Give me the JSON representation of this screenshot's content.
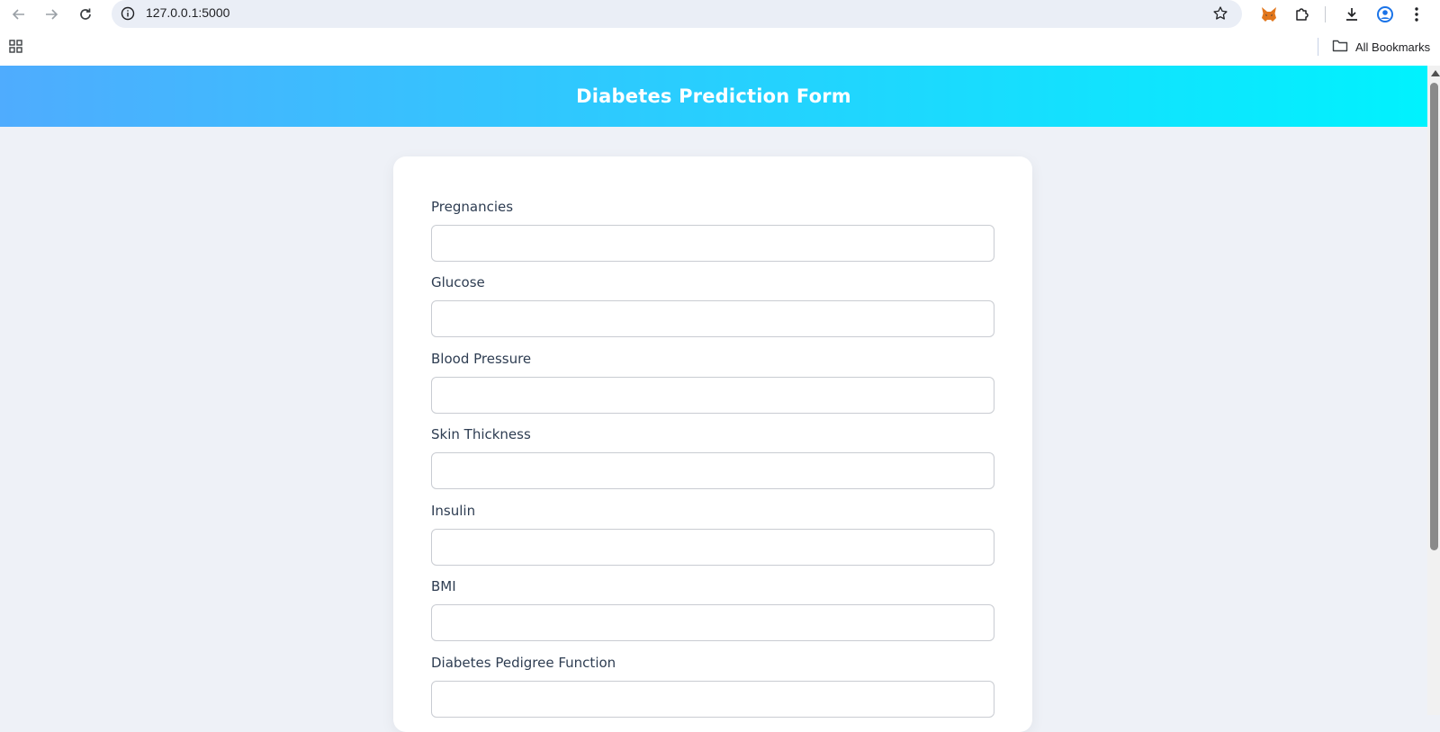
{
  "browser": {
    "url": "127.0.0.1:5000",
    "bookmarks_label": "All Bookmarks",
    "icons": [
      "back-icon",
      "forward-icon",
      "reload-icon",
      "site-info-icon",
      "bookmark-star-icon",
      "metamask-fox-icon",
      "extensions-puzzle-icon",
      "download-icon",
      "profile-icon",
      "menu-kebab-icon",
      "apps-grid-icon",
      "folder-icon"
    ]
  },
  "page": {
    "title": "Diabetes Prediction Form",
    "header_gradient": [
      "#4facfe",
      "#00f2fe"
    ]
  },
  "form": {
    "fields": [
      {
        "label": "Pregnancies",
        "value": ""
      },
      {
        "label": "Glucose",
        "value": ""
      },
      {
        "label": "Blood Pressure",
        "value": ""
      },
      {
        "label": "Skin Thickness",
        "value": ""
      },
      {
        "label": "Insulin",
        "value": ""
      },
      {
        "label": "BMI",
        "value": ""
      },
      {
        "label": "Diabetes Pedigree Function",
        "value": ""
      }
    ]
  }
}
